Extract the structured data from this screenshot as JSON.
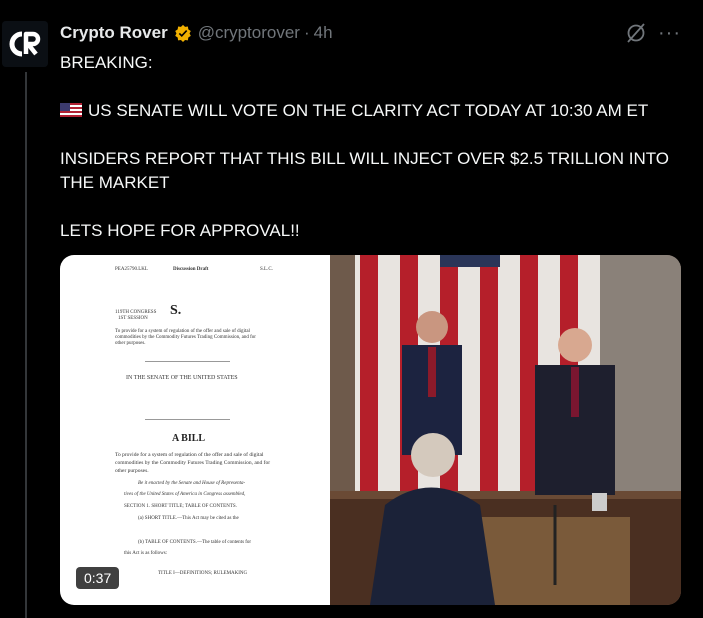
{
  "author": {
    "name": "Crypto Rover",
    "handle": "@cryptorover",
    "separator": "·",
    "time": "4h",
    "avatar_text": "CR",
    "verified_color": "#f2b100"
  },
  "tweet": {
    "lines": [
      "BREAKING:",
      "US SENATE WILL VOTE ON THE CLARITY ACT TODAY AT 10:30 AM ET",
      "INSIDERS REPORT THAT THIS BILL WILL INJECT OVER $2.5 TRILLION INTO THE MARKET",
      "LETS HOPE FOR APPROVAL!!"
    ],
    "flag_icon": "us-flag-emoji"
  },
  "media": {
    "duration": "0:37",
    "document": {
      "header_left": "PEA25790.LKL",
      "header_center": "Discussion Draft",
      "header_right": "S.L.C.",
      "congress": "119TH CONGRESS",
      "session": "1ST SESSION",
      "bill_prefix": "S.",
      "intro": "To provide for a system of regulation of the offer and sale of digital commodities by the Commodity Futures Trading Commission, and for other purposes.",
      "senate": "IN THE SENATE OF THE UNITED STATES",
      "a_bill": "A BILL",
      "purpose": "To provide for a system of regulation of the offer and sale of digital commodities by the Commodity Futures Trading Commission, and for other purposes.",
      "enact_1": "Be it enacted by the Senate and House of Representa-",
      "enact_2": "tives of the United States of America in Congress assembled,",
      "sec1": "SECTION 1. SHORT TITLE; TABLE OF CONTENTS.",
      "short_title": "(a) SHORT TITLE.—This Act may be cited as the",
      "toc": "(b) TABLE OF CONTENTS.—The table of contents for",
      "toc2": "this Act is as follows:",
      "title_line": "TITLE I—DEFINITIONS; RULEMAKING"
    }
  },
  "actions": {
    "grok_icon": "grok-icon",
    "more_icon": "more-icon"
  }
}
